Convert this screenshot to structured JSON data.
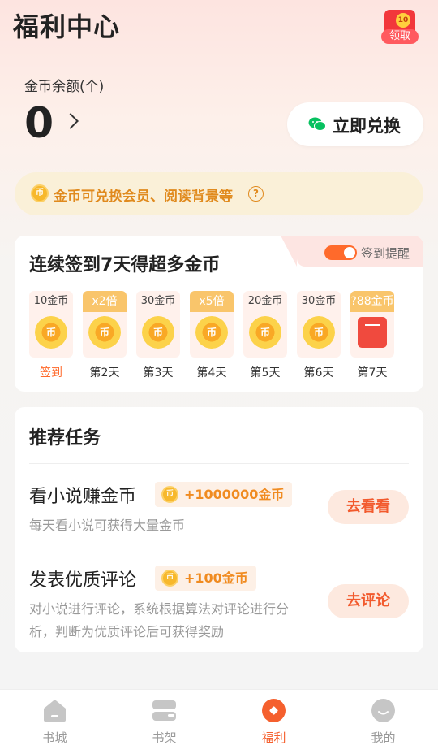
{
  "header": {
    "title": "福利中心",
    "redpacket_label": "领取",
    "redpacket_badge": "10"
  },
  "balance": {
    "label": "金币余额(个)",
    "value": "0",
    "exchange_label": "立即兑换"
  },
  "tip": {
    "coin": "币",
    "text": "金币可兑换会员、阅读背景等",
    "help": "?"
  },
  "signin": {
    "title": "连续签到7天得超多金币",
    "remind_label": "签到提醒",
    "remind_on": true,
    "days": [
      {
        "top": "10金币",
        "label": "签到",
        "active": true,
        "boost": false,
        "gift": false,
        "coin": "币"
      },
      {
        "top": "x2倍",
        "label": "第2天",
        "active": false,
        "boost": true,
        "gift": false,
        "coin": "币"
      },
      {
        "top": "30金币",
        "label": "第3天",
        "active": false,
        "boost": false,
        "gift": false,
        "coin": "币"
      },
      {
        "top": "x5倍",
        "label": "第4天",
        "active": false,
        "boost": true,
        "gift": false,
        "coin": "币"
      },
      {
        "top": "20金币",
        "label": "第5天",
        "active": false,
        "boost": false,
        "gift": false,
        "coin": "币"
      },
      {
        "top": "30金币",
        "label": "第6天",
        "active": false,
        "boost": false,
        "gift": false,
        "coin": "币"
      },
      {
        "top": "?88金币",
        "label": "第7天",
        "active": false,
        "boost": true,
        "gift": true,
        "coin": ""
      }
    ]
  },
  "tasks": {
    "title": "推荐任务",
    "items": [
      {
        "name": "看小说赚金币",
        "reward": "+1000000金币",
        "coin": "币",
        "desc": "每天看小说可获得大量金币",
        "button": "去看看"
      },
      {
        "name": "发表优质评论",
        "reward": "+100金币",
        "coin": "币",
        "desc": "对小说进行评论，系统根据算法对评论进行分析，判断为优质评论后可获得奖励",
        "button": "去评论"
      }
    ]
  },
  "nav": {
    "items": [
      {
        "label": "书城",
        "icon": "home-icon",
        "active": false
      },
      {
        "label": "书架",
        "icon": "bookshelf-icon",
        "active": false
      },
      {
        "label": "福利",
        "icon": "welfare-icon",
        "active": true
      },
      {
        "label": "我的",
        "icon": "profile-icon",
        "active": false
      }
    ]
  },
  "colors": {
    "accent": "#ff6a2b",
    "coin_gold": "#f7b82c",
    "reward_orange": "#f08b20",
    "redpacket_red": "#f2373b",
    "wechat_green": "#07c160"
  }
}
